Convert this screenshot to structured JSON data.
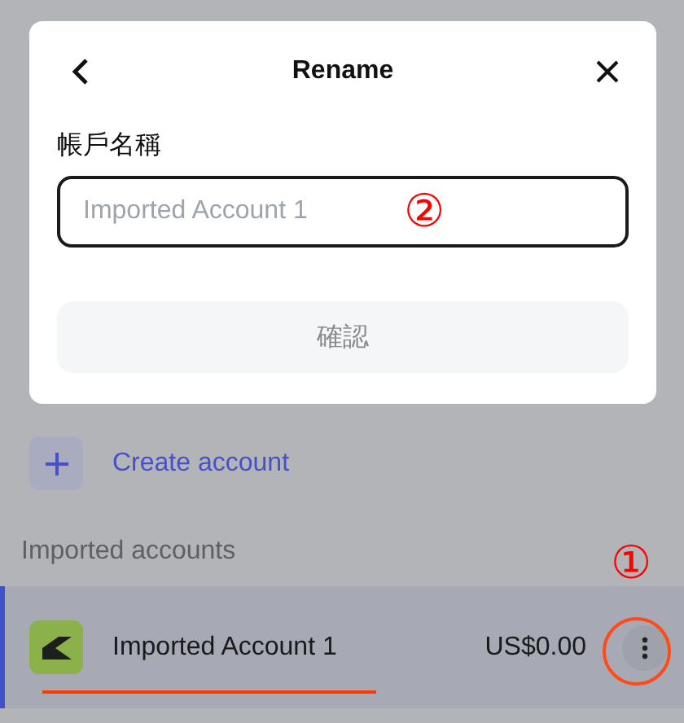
{
  "dialog": {
    "title": "Rename",
    "field_label": "帳戶名稱",
    "name_field": {
      "placeholder": "Imported Account 1"
    },
    "confirm_button": {
      "label": "確認",
      "disabled": true
    }
  },
  "create_account": {
    "label": "Create account"
  },
  "imported_section": {
    "heading": "Imported accounts",
    "accounts": [
      {
        "name": "Imported Account 1",
        "balance": "US$0.00",
        "selected": true
      }
    ]
  },
  "annotations": [
    {
      "kind": "number",
      "text": "②"
    },
    {
      "kind": "number",
      "text": "①"
    }
  ]
}
